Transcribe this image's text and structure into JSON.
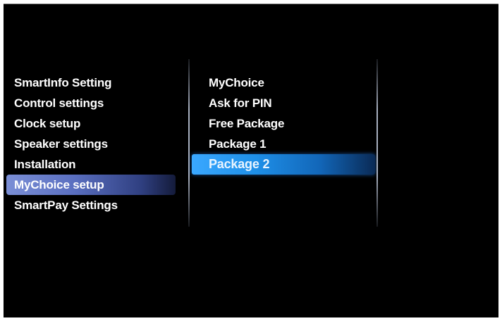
{
  "left_menu": {
    "items": [
      {
        "label": "SmartInfo Setting"
      },
      {
        "label": "Control settings"
      },
      {
        "label": "Clock setup"
      },
      {
        "label": "Speaker settings"
      },
      {
        "label": "Installation"
      },
      {
        "label": "MyChoice setup"
      },
      {
        "label": "SmartPay Settings"
      }
    ],
    "highlighted_index": 5,
    "highlight_color": "#5a6fc0"
  },
  "right_menu": {
    "items": [
      {
        "label": "MyChoice"
      },
      {
        "label": "Ask for PIN"
      },
      {
        "label": "Free Package"
      },
      {
        "label": "Package 1"
      },
      {
        "label": "Package 2"
      }
    ],
    "selected_index": 4,
    "selection_color": "#1e8fe8"
  },
  "colors": {
    "background": "#000000",
    "text": "#ffffff"
  }
}
